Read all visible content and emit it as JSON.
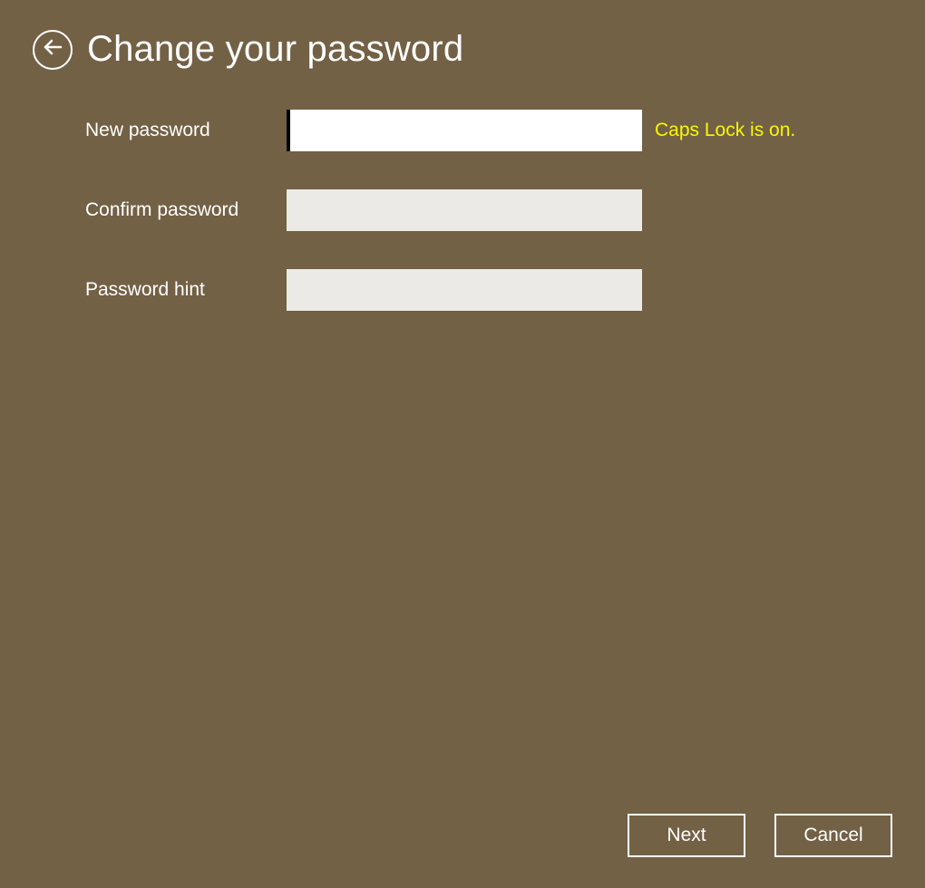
{
  "header": {
    "title": "Change your password"
  },
  "form": {
    "new_password": {
      "label": "New password",
      "value": ""
    },
    "confirm_password": {
      "label": "Confirm password",
      "value": ""
    },
    "password_hint": {
      "label": "Password hint",
      "value": ""
    },
    "caps_lock_warning": "Caps Lock is on."
  },
  "buttons": {
    "next": "Next",
    "cancel": "Cancel"
  }
}
